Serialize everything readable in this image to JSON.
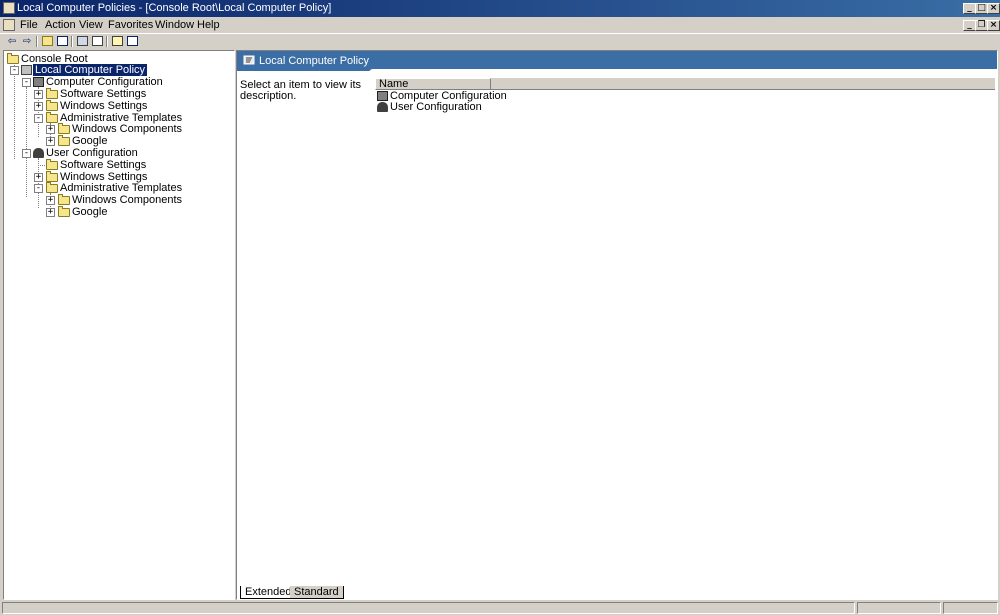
{
  "window": {
    "title": "Local Computer Policies - [Console Root\\Local Computer Policy]"
  },
  "menu": {
    "items": [
      "File",
      "Action",
      "View",
      "Favorites",
      "Window",
      "Help"
    ]
  },
  "toolbar": {
    "buttons": [
      "back-icon",
      "forward-icon",
      "up-folder-icon",
      "show-tree-icon",
      "new-window-icon",
      "export-list-icon",
      "help-icon",
      "properties-icon"
    ]
  },
  "tree": {
    "root": "Console Root",
    "policy": "Local Computer Policy",
    "computer": {
      "label": "Computer Configuration",
      "software": "Software Settings",
      "windows": "Windows Settings",
      "admin": "Administrative Templates",
      "components": "Windows Components",
      "google": "Google"
    },
    "user": {
      "label": "User Configuration",
      "software": "Software Settings",
      "windows": "Windows Settings",
      "admin": "Administrative Templates",
      "components": "Windows Components",
      "google": "Google"
    }
  },
  "details": {
    "header_title": "Local Computer Policy",
    "description": "Select an item to view its description.",
    "column_name": "Name",
    "items": [
      "Computer Configuration",
      "User Configuration"
    ]
  },
  "view_tabs": {
    "extended": "Extended",
    "standard": "Standard"
  },
  "colors": {
    "title_bar": "#0a246a",
    "header_band": "#3a6ea5",
    "selection": "#0a246a",
    "chrome": "#d4d0c8"
  }
}
